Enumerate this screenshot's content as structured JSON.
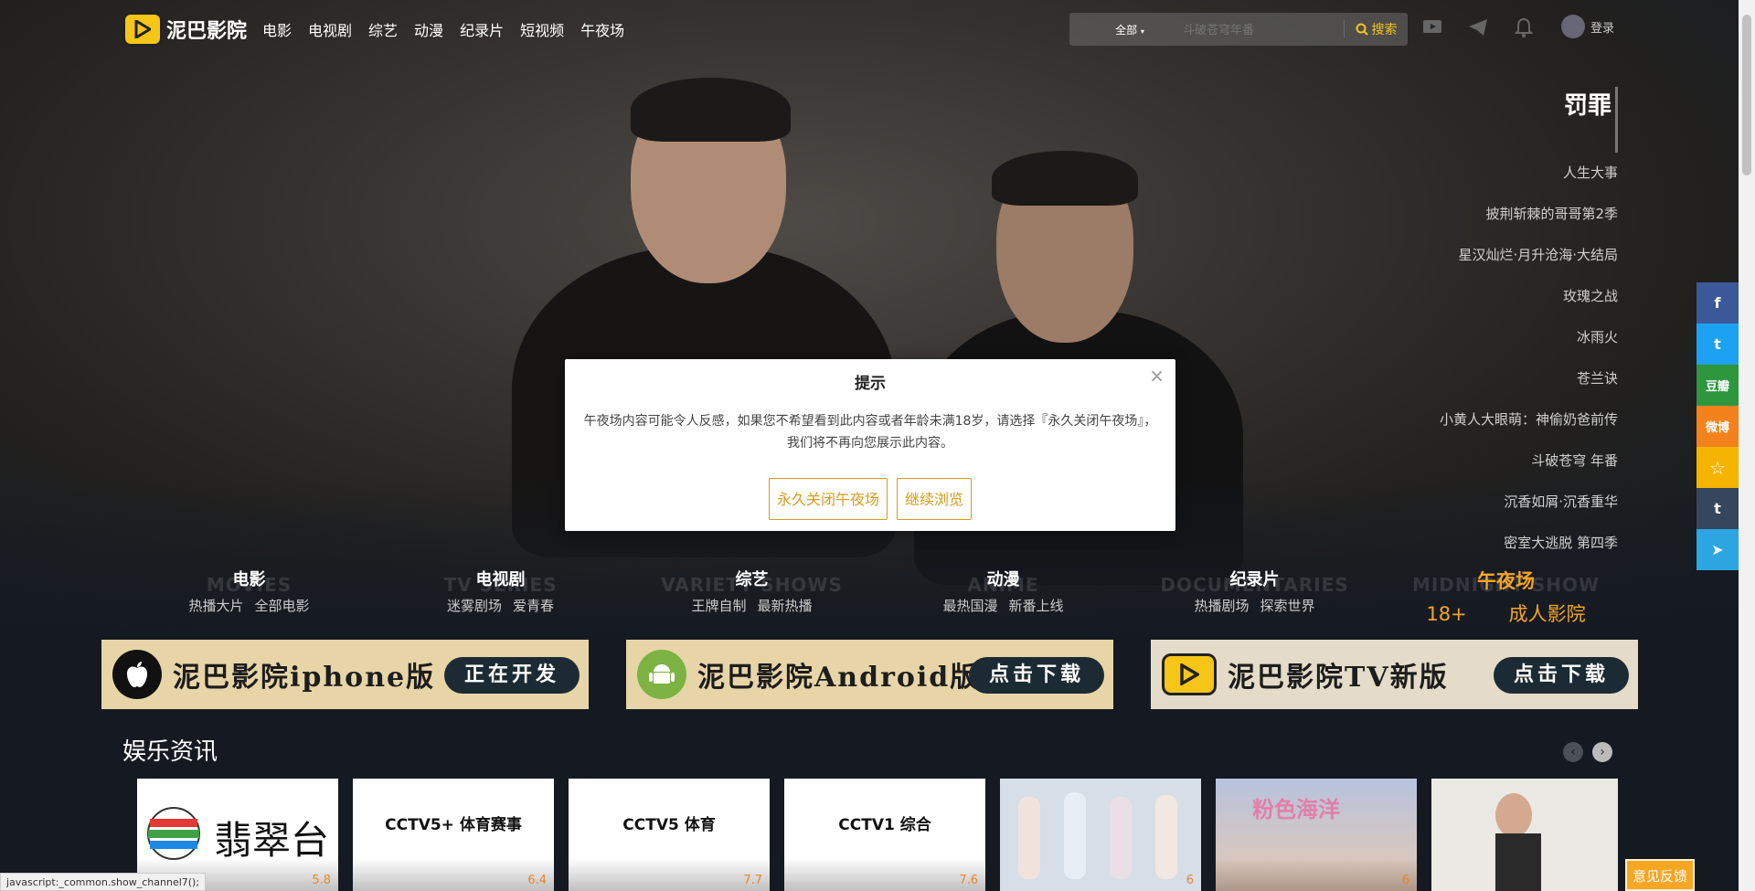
{
  "brand": {
    "name": "泥巴影院"
  },
  "nav": {
    "links": [
      "电影",
      "电视剧",
      "综艺",
      "动漫",
      "纪录片",
      "短视频",
      "午夜场"
    ]
  },
  "search": {
    "category": "全部",
    "placeholder": "斗破苍穹年番",
    "button": "搜索"
  },
  "user": {
    "login": "登录"
  },
  "hero": {
    "active": "罚罪",
    "list": [
      "人生大事",
      "披荆斩棘的哥哥第2季",
      "星汉灿烂·月升沧海·大结局",
      "玫瑰之战",
      "冰雨火",
      "苍兰诀",
      "小黄人大眼萌：神偷奶爸前传",
      "斗破苍穹 年番",
      "沉香如屑·沉香重华",
      "密室大逃脱 第四季"
    ]
  },
  "modal": {
    "title": "提示",
    "message": "午夜场内容可能令人反感，如果您不希望看到此内容或者年龄未满18岁，请选择『永久关闭午夜场』，我们将不再向您展示此内容。",
    "close_btn": "永久关闭午夜场",
    "continue_btn": "继续浏览"
  },
  "categories": [
    {
      "title": "电影",
      "bg": "MOVIES",
      "subs": [
        "热播大片",
        "全部电影"
      ]
    },
    {
      "title": "电视剧",
      "bg": "TV SERIES",
      "subs": [
        "迷雾剧场",
        "爱青春"
      ]
    },
    {
      "title": "综艺",
      "bg": "VARIETY SHOWS",
      "subs": [
        "王牌自制",
        "最新热播"
      ]
    },
    {
      "title": "动漫",
      "bg": "ANIME",
      "subs": [
        "最热国漫",
        "新番上线"
      ]
    },
    {
      "title": "纪录片",
      "bg": "DOCUMENTARIES",
      "subs": [
        "热播剧场",
        "探索世界"
      ]
    },
    {
      "title": "午夜场",
      "bg": "MIDNIGHT SHOW",
      "subs": [
        "18+",
        "成人影院"
      ]
    }
  ],
  "banners": [
    {
      "text": "泥巴影院iphone版",
      "button": "正在开发",
      "icon": "apple-icon"
    },
    {
      "text": "泥巴影院Android版",
      "button": "点击下载",
      "icon": "android-icon"
    },
    {
      "text": "泥巴影院TV新版",
      "button": "点击下载",
      "icon": "play-icon"
    }
  ],
  "news": {
    "title": "娱乐资讯",
    "cards": [
      {
        "name": "翡翠台",
        "score": "5.8"
      },
      {
        "name": "CCTV5+ 体育赛事",
        "score": "6.4"
      },
      {
        "name": "CCTV5 体育",
        "score": "7.7"
      },
      {
        "name": "CCTV1 综合",
        "score": "7.6"
      },
      {
        "name": "",
        "score": "6"
      },
      {
        "name": "粉色海洋",
        "score": "6"
      },
      {
        "name": "",
        "score": ""
      }
    ]
  },
  "share": [
    "f",
    "t",
    "豆瓣",
    "微博",
    "☆",
    "t",
    "➤"
  ],
  "status": {
    "url": "javascript:_common.show_channel7();"
  },
  "feedback": "意见反馈",
  "colors": {
    "accent": "#f5c518",
    "night": "#f5a623",
    "modal_btn": "#d99b1b"
  }
}
